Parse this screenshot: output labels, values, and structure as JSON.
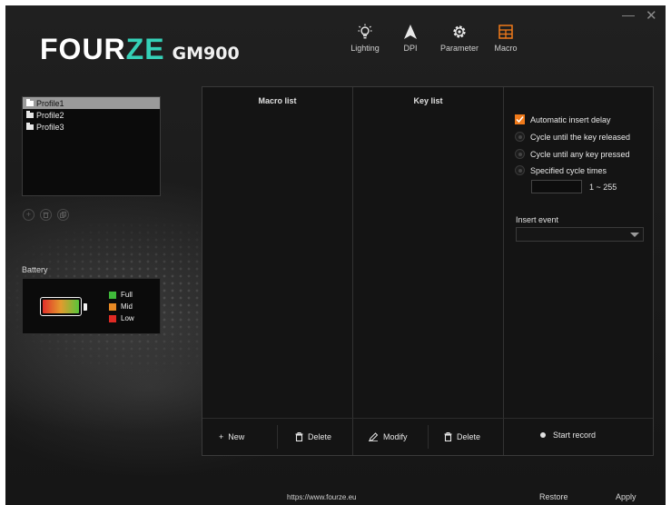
{
  "brand": {
    "part1": "FOUR",
    "part2": "ZE",
    "model": "GM900",
    "accent": "#35d0b7"
  },
  "window": {
    "minimize_glyph": "—",
    "close_glyph": "✕"
  },
  "nav": [
    {
      "label": "Lighting",
      "icon": "lightbulb-icon"
    },
    {
      "label": "DPI",
      "icon": "arrow-cursor-icon"
    },
    {
      "label": "Parameter",
      "icon": "gear-icon"
    },
    {
      "label": "Macro",
      "icon": "grid-icon",
      "active": true
    }
  ],
  "profiles": {
    "items": [
      "Profile1",
      "Profile2",
      "Profile3"
    ],
    "selected": "Profile1"
  },
  "battery": {
    "title": "Battery",
    "legend": [
      {
        "label": "Full",
        "color": "#3fb93a"
      },
      {
        "label": "Mid",
        "color": "#e88a24"
      },
      {
        "label": "Low",
        "color": "#e02a24"
      }
    ]
  },
  "macro": {
    "macro_list_header": "Macro list",
    "key_list_header": "Key list",
    "new_label": "New",
    "delete_label": "Delete",
    "modify_label": "Modify",
    "key_delete_label": "Delete",
    "options": {
      "auto_delay": "Automatic insert delay",
      "cycle_release": "Cycle until the key released",
      "cycle_any": "Cycle until any key pressed",
      "cycle_times": "Specified cycle times",
      "cycle_value": "",
      "range": "1 ~ 255"
    },
    "insert_event_label": "Insert event",
    "insert_event_value": "",
    "start_record": "Start record",
    "checkbox_color": "#f07a1a"
  },
  "footer": {
    "url": "https://www.fourze.eu",
    "restore": "Restore",
    "apply": "Apply"
  }
}
